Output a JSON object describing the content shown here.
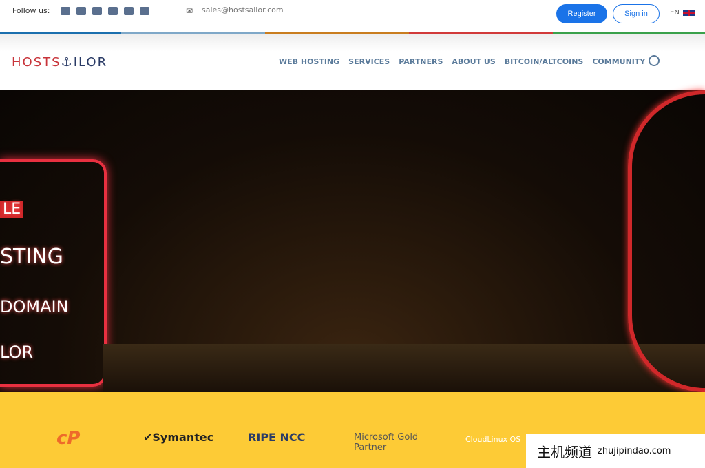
{
  "topbar": {
    "follow_label": "Follow us:",
    "social": [
      "facebook-icon",
      "twitter-icon",
      "instagram-icon",
      "linkedin-icon",
      "telegram-icon",
      "youtube-icon"
    ],
    "email": "sales@hostsailor.com",
    "register": "Register",
    "signin": "Sign in",
    "lang": "EN"
  },
  "stripes": [
    "#1b6fae",
    "#7fa8c8",
    "#c97d1f",
    "#d13a3a",
    "#3aa14b"
  ],
  "nav": {
    "logo_a": "HOSTS",
    "logo_b": "⚓ILOR",
    "items": [
      "WEB HOSTING",
      "SERVICES",
      "PARTNERS",
      "ABOUT US",
      "BITCOIN/ALTCOINS",
      "COMMUNITY"
    ]
  },
  "hero": {
    "sign": [
      "LE",
      "STING",
      "DOMAIN",
      "LOR"
    ]
  },
  "partners": [
    "cP",
    "Symantec",
    "RIPE NCC",
    "Microsoft Gold Partner",
    "CloudLinux OS"
  ],
  "watermark": {
    "cn": "主机频道",
    "en": "zhujipindao.com"
  }
}
